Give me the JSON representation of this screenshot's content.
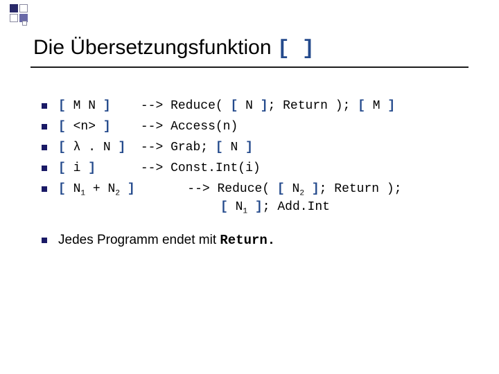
{
  "title": {
    "text": "Die Übersetzungsfunktion ",
    "symbol": "[ ]"
  },
  "rules": [
    {
      "lhs_open": "[",
      "lhs_body": " M N ",
      "lhs_close": "]",
      "arrow_pad": "    --> ",
      "rhs_pre": "Reduce( ",
      "rhs_b1_open": "[",
      "rhs_b1_body": " N ",
      "rhs_b1_close": "]",
      "rhs_mid": "; Return ); ",
      "rhs_b2_open": "[",
      "rhs_b2_body": " M ",
      "rhs_b2_close": "]"
    },
    {
      "lhs_open": "[",
      "lhs_body": " <n> ",
      "lhs_close": "]",
      "arrow_pad": "    --> ",
      "rhs": "Access(n)"
    },
    {
      "lhs_open": "[",
      "lhs_body": " λ . N ",
      "lhs_close": "]",
      "arrow_pad": "  --> ",
      "rhs_pre": "Grab; ",
      "rhs_b_open": "[",
      "rhs_b_body": " N ",
      "rhs_b_close": "]"
    },
    {
      "lhs_open": "[",
      "lhs_body": " i ",
      "lhs_close": "]",
      "arrow_pad": "      --> ",
      "rhs": "Const.Int(i)"
    },
    {
      "lhs_open": "[",
      "lhs_body_pre": " N",
      "sub1": "1",
      "lhs_body_mid": " + N",
      "sub2": "2",
      "lhs_body_post": " ",
      "lhs_close": "]",
      "arrow_pad": "       --> ",
      "rhs_pre": "Reduce( ",
      "rhs_b1_open": "[",
      "rhs_b1_body_pre": " N",
      "rhs_b1_sub": "2",
      "rhs_b1_body_post": " ",
      "rhs_b1_close": "]",
      "rhs_mid": "; Return );",
      "cont_b_open": "[",
      "cont_b_body_pre": " N",
      "cont_b_sub": "1",
      "cont_b_body_post": " ",
      "cont_b_close": "]",
      "cont_rest": "; Add.Int"
    }
  ],
  "footer": {
    "text_pre": "Jedes Programm endet mit ",
    "code": " Return."
  }
}
